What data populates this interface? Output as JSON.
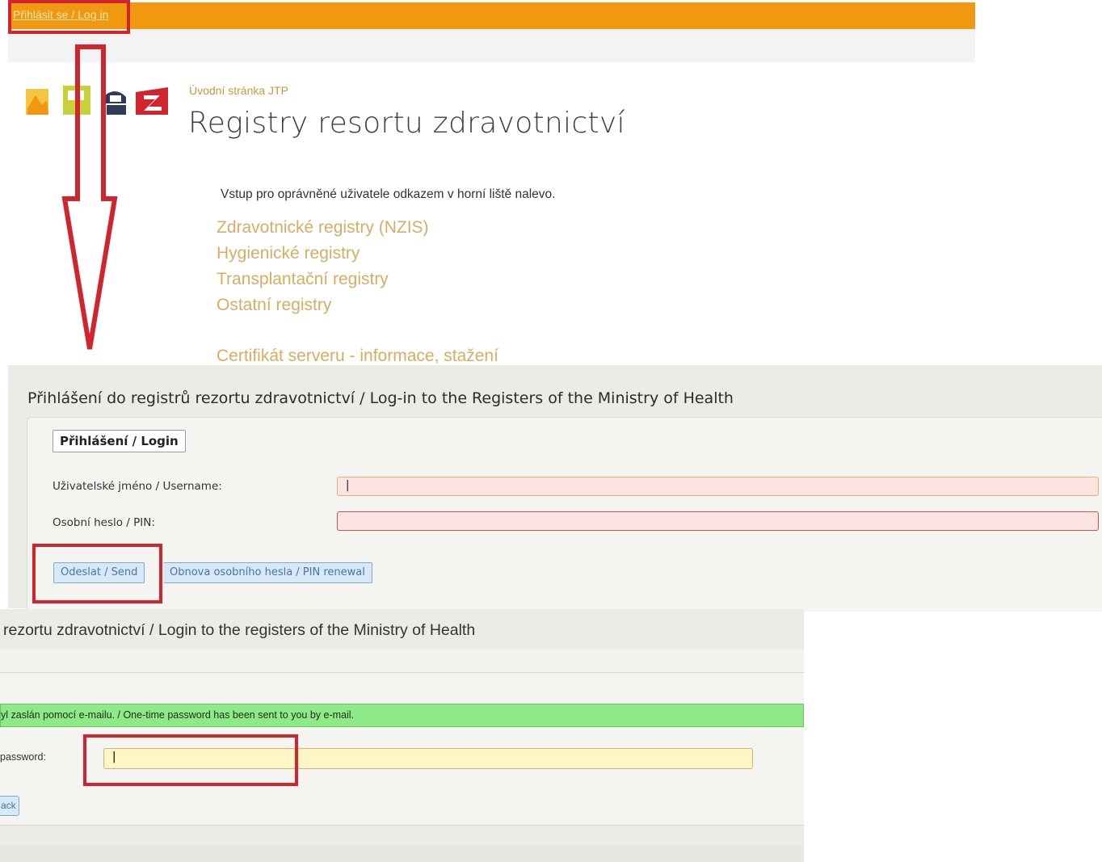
{
  "portal": {
    "login_link": "Přihlásit se / Log in",
    "breadcrumb": "Úvodní stránka JTP",
    "title": "Registry resortu zdravotnictví",
    "intro": "Vstup pro oprávněné uživatele odkazem v horní liště nalevo.",
    "links": [
      "Zdravotnické registry (NZIS)",
      "Hygienické registry",
      "Transplantační registry",
      "Ostatní registry"
    ],
    "certificate_link": "Certifikát serveru - informace, stažení",
    "colors": {
      "topbar": "#f0980f",
      "link": "#d6ad63"
    }
  },
  "login_form": {
    "heading": "Přihlášení do registrů rezortu zdravotnictví / Log-in to the Registers of the Ministry of Health",
    "legend": "Přihlášení / Login",
    "username_label": "Uživatelské jméno / Username:",
    "username_value": "|",
    "pin_label": "Osobní heslo / PIN:",
    "pin_value": "",
    "send_button": "Odeslat / Send",
    "renew_button": "Obnova osobního hesla / PIN renewal"
  },
  "otp_form": {
    "heading": "rezortu zdravotnictví / Login to the registers of the Ministry of Health",
    "banner": "yl zaslán pomocí e-mailu. / One-time password has been sent to you by e-mail.",
    "label": "password:",
    "value": "|",
    "back_button": "ack"
  },
  "annotation_color": "#d1242f"
}
